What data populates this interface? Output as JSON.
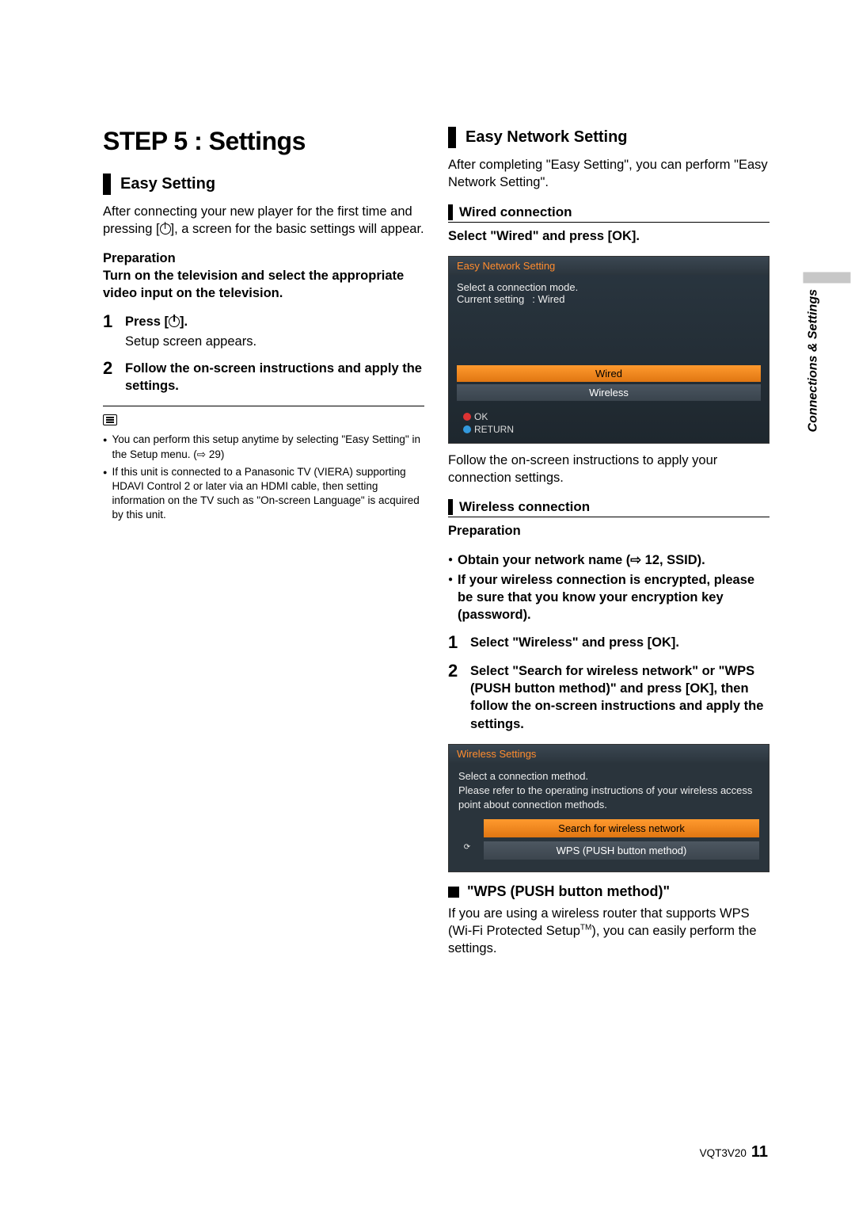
{
  "title": "STEP 5 : Settings",
  "left": {
    "h2": "Easy Setting",
    "intro_a": "After connecting your new player for the first time and pressing [",
    "intro_b": "], a screen for the basic settings will appear.",
    "prep_label": "Preparation",
    "prep_text": "Turn on the television and select the appropriate video input on the television.",
    "steps": [
      {
        "num": "1",
        "bold_a": "Press [",
        "bold_b": "].",
        "sub": "Setup screen appears."
      },
      {
        "num": "2",
        "bold": "Follow the on-screen instructions and apply the settings."
      }
    ],
    "notes": [
      "You can perform this setup anytime by selecting \"Easy Setting\" in the Setup menu. (⇨ 29)",
      "If this unit is connected to a Panasonic TV (VIERA) supporting HDAVI Control 2 or later via an HDMI cable, then setting information on the TV such as \"On-screen Language\" is acquired by this unit."
    ]
  },
  "right": {
    "h2": "Easy Network Setting",
    "intro": "After completing \"Easy Setting\", you can perform \"Easy Network Setting\".",
    "wired": {
      "h3": "Wired connection",
      "instr": "Select \"Wired\" and press [OK].",
      "osd": {
        "title": "Easy Network Setting",
        "line1": "Select a connection mode.",
        "cur_label": "Current setting",
        "cur_value": ":  Wired",
        "opts": [
          "Wired",
          "Wireless"
        ],
        "ok": "OK",
        "return": "RETURN"
      },
      "follow": "Follow the on-screen instructions to apply your connection settings."
    },
    "wireless": {
      "h3": "Wireless connection",
      "prep_label": "Preparation",
      "bullets": [
        "Obtain your network name (⇨ 12, SSID).",
        "If your wireless connection is encrypted, please be sure that you know your encryption key (password)."
      ],
      "steps": [
        {
          "num": "1",
          "bold": "Select \"Wireless\" and press [OK]."
        },
        {
          "num": "2",
          "bold": "Select \"Search for wireless network\" or \"WPS (PUSH button method)\" and press [OK], then follow the on-screen instructions and apply the settings."
        }
      ],
      "osd": {
        "title": "Wireless Settings",
        "body": "Select a connection method.\nPlease refer to the operating instructions of your wireless access point about connection methods.",
        "opts": [
          "Search for wireless network",
          "WPS (PUSH button method)"
        ]
      },
      "wps_h": "\"WPS (PUSH button method)\"",
      "wps_body_a": "If you are using a wireless router that supports WPS (Wi-Fi Protected Setup",
      "wps_tm": "TM",
      "wps_body_b": "), you can easily perform the settings."
    }
  },
  "side_tab": "Connections & Settings",
  "footer_code": "VQT3V20",
  "footer_page": "11"
}
